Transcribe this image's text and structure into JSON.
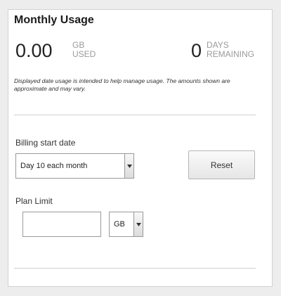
{
  "widget": {
    "title": "Monthly Usage",
    "used": {
      "value": "0.00",
      "unit_line1": "GB",
      "unit_line2": "USED"
    },
    "remaining": {
      "value": "0",
      "unit_line1": "DAYS",
      "unit_line2": "REMAINING"
    },
    "disclaimer": "Displayed date usage is intended to help manage usage. The amounts shown are approximate and may vary."
  },
  "billing": {
    "label": "Billing start date",
    "selected": "Day 10 each month",
    "reset_label": "Reset"
  },
  "plan": {
    "label": "Plan Limit",
    "limit_value": "",
    "unit_selected": "GB"
  },
  "icons": {
    "dropdown": "chevron-down-icon"
  }
}
